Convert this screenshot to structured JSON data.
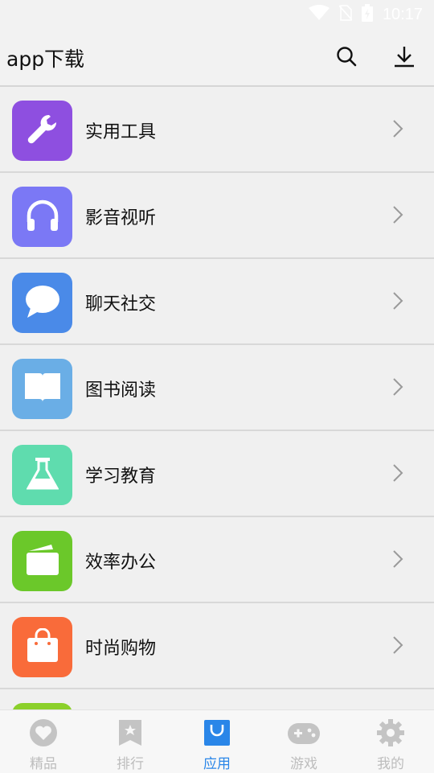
{
  "status": {
    "time": "10:17"
  },
  "header": {
    "title": "app下载"
  },
  "categories": [
    {
      "label": "实用工具",
      "icon": "wrench-icon",
      "color": "#8e4fe0"
    },
    {
      "label": "影音视听",
      "icon": "headphones-icon",
      "color": "#7b78f5"
    },
    {
      "label": "聊天社交",
      "icon": "chat-bubble-icon",
      "color": "#4a8ae8"
    },
    {
      "label": "图书阅读",
      "icon": "open-book-icon",
      "color": "#6aaee6"
    },
    {
      "label": "学习教育",
      "icon": "flask-icon",
      "color": "#5fdcae"
    },
    {
      "label": "效率办公",
      "icon": "folder-icon",
      "color": "#6bc82a"
    },
    {
      "label": "时尚购物",
      "icon": "shopping-bag-icon",
      "color": "#f96b3a"
    }
  ],
  "partial_color": "#8bd02a",
  "tabs": [
    {
      "label": "精品",
      "icon": "heart-icon"
    },
    {
      "label": "排行",
      "icon": "bookmark-star-icon"
    },
    {
      "label": "应用",
      "icon": "app-bag-icon",
      "active": true
    },
    {
      "label": "游戏",
      "icon": "gamepad-icon"
    },
    {
      "label": "我的",
      "icon": "gear-icon"
    }
  ],
  "colors": {
    "accent": "#2a86e8",
    "tab_inactive": "#bdbdbd"
  }
}
